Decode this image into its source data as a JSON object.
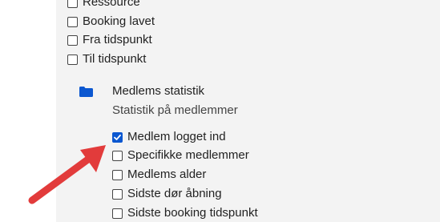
{
  "top_group": {
    "items": [
      {
        "label": "Ressource",
        "checked": false
      },
      {
        "label": "Booking lavet",
        "checked": false
      },
      {
        "label": "Fra tidspunkt",
        "checked": false
      },
      {
        "label": "Til tidspunkt",
        "checked": false
      }
    ]
  },
  "section": {
    "icon": "folder-icon",
    "title": "Medlems statistik",
    "subtitle": "Statistik på medlemmer",
    "items": [
      {
        "label": "Medlem logget ind",
        "checked": true
      },
      {
        "label": "Specifikke medlemmer",
        "checked": false
      },
      {
        "label": "Medlems alder",
        "checked": false
      },
      {
        "label": "Sidste dør åbning",
        "checked": false
      },
      {
        "label": "Sidste booking tidspunkt",
        "checked": false
      }
    ]
  },
  "colors": {
    "accent": "#0b57d0",
    "panel_bg": "#f3f3f3",
    "arrow": "#e23b3b"
  }
}
